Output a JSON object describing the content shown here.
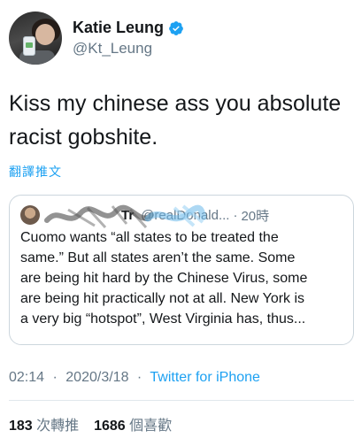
{
  "author": {
    "display_name": "Katie Leung",
    "handle": "@Kt_Leung",
    "verified": true,
    "verified_color": "#1da1f2"
  },
  "tweet": {
    "line1": "Kiss my chinese ass you absolute",
    "line2": "racist gobshite.",
    "translate_label": "翻譯推文"
  },
  "quoted": {
    "name_visible": "Tr",
    "handle": "@realDonald...",
    "separator": "·",
    "time": "20時",
    "lines": [
      "Cuomo wants “all states to be treated the",
      "same.” But all states aren’t the same. Some",
      "are being hit hard by the Chinese Virus, some",
      "are being hit practically not at all. New York is",
      "a very big “hotspot”, West Virginia has, thus..."
    ]
  },
  "meta": {
    "time": "02:14",
    "separator": "·",
    "date": "2020/3/18",
    "source": "Twitter for iPhone"
  },
  "stats": {
    "retweets": "183",
    "retweets_label": "次轉推",
    "likes": "1686",
    "likes_label": "個喜歡"
  },
  "colors": {
    "link": "#1da1f2",
    "secondary_text": "#657786",
    "primary_text": "#14171a",
    "border": "#ccd6dd"
  }
}
